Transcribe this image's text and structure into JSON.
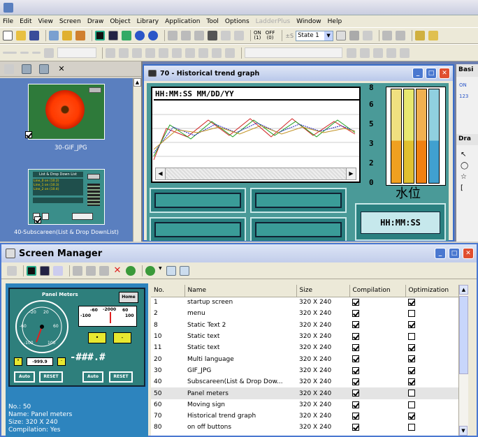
{
  "menu": [
    "File",
    "Edit",
    "View",
    "Screen",
    "Draw",
    "Object",
    "Library",
    "Application",
    "Tool",
    "Options",
    "LadderPlus",
    "Window",
    "Help"
  ],
  "menu_disabled": [
    "LadderPlus"
  ],
  "toolbar": {
    "state_label": "State 1",
    "on_label": "ON",
    "off_label": "OFF",
    "on_sub": "(1)",
    "off_sub": "(0)"
  },
  "thumbs": [
    {
      "label": "30-GIF_JPG"
    },
    {
      "label": "40-Subscareen(List & Drop DownList)",
      "inner_title": "List & Drop Down List",
      "items": [
        "Line_0 on (10.2)",
        "Line_1 on (10.3)",
        "Line_2 on (10.4)"
      ]
    }
  ],
  "child": {
    "title": "70 - Historical trend graph",
    "timestamp": "HH:MM:SS  MM/DD/YY",
    "y_ticks": [
      "8",
      "6",
      "5",
      "3",
      "2",
      "0"
    ],
    "water_label": "水位",
    "time_label": "HH:MM:SS"
  },
  "right_pane": {
    "title": "Basi",
    "items": [
      "ON",
      "123",
      "Dra"
    ]
  },
  "screen_manager": {
    "title": "Screen Manager",
    "columns": [
      "No.",
      "Name",
      "Size",
      "Compilation",
      "Optimization"
    ],
    "rows": [
      {
        "no": "1",
        "name": "startup screen",
        "size": "320 X 240",
        "comp": true,
        "opt": true
      },
      {
        "no": "2",
        "name": "menu",
        "size": "320 X 240",
        "comp": true,
        "opt": false
      },
      {
        "no": "8",
        "name": "Static Text 2",
        "size": "320 X 240",
        "comp": true,
        "opt": true
      },
      {
        "no": "10",
        "name": "Static text",
        "size": "320 X 240",
        "comp": true,
        "opt": false
      },
      {
        "no": "11",
        "name": "Static text",
        "size": "320 X 240",
        "comp": true,
        "opt": true
      },
      {
        "no": "20",
        "name": "Multi language",
        "size": "320 X 240",
        "comp": true,
        "opt": true
      },
      {
        "no": "30",
        "name": "GIF_JPG",
        "size": "320 X 240",
        "comp": true,
        "opt": true
      },
      {
        "no": "40",
        "name": "Subscareen(List & Drop Dow...",
        "size": "320 X 240",
        "comp": true,
        "opt": true
      },
      {
        "no": "50",
        "name": "Panel meters",
        "size": "320 X 240",
        "comp": true,
        "opt": false,
        "selected": true
      },
      {
        "no": "60",
        "name": "Moving sign",
        "size": "320 X 240",
        "comp": true,
        "opt": false
      },
      {
        "no": "70",
        "name": "Historical trend graph",
        "size": "320 X 240",
        "comp": true,
        "opt": true
      },
      {
        "no": "80",
        "name": "on off buttons",
        "size": "320 X 240",
        "comp": true,
        "opt": false
      }
    ],
    "preview": {
      "panel_title": "Panel Meters",
      "home": "Home",
      "gauge_ticks": [
        "-20",
        "20",
        "-60",
        "60",
        "-100",
        "100"
      ],
      "meter_ticks": [
        "-60",
        "-2000",
        "60",
        "-100",
        "100"
      ],
      "readout": "-999.9",
      "display": "-###.#",
      "auto": "Auto",
      "reset": "RESET",
      "info": [
        "No.: 50",
        "Name: Panel meters",
        "Size: 320 X 240",
        "Compilation: Yes"
      ]
    }
  }
}
